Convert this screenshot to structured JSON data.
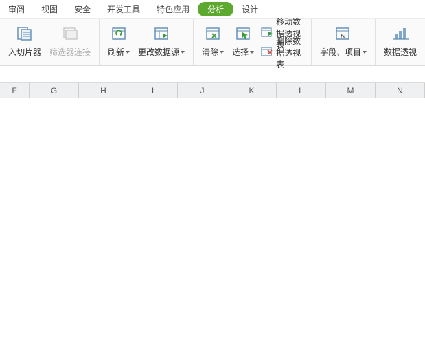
{
  "tabs": {
    "review": "审阅",
    "view": "视图",
    "security": "安全",
    "devtools": "开发工具",
    "featured": "特色应用",
    "analysis": "分析",
    "design": "设计"
  },
  "ribbon": {
    "slicer": "入切片器",
    "filter_conn": "筛选器连接",
    "refresh": "刷新",
    "change_source": "更改数据源",
    "clear": "清除",
    "select": "选择",
    "move_pivot": "移动数据透视表",
    "delete_pivot": "删除数据透视表",
    "fields_items": "字段、项目",
    "pivot_chart_partial": "数据透视"
  },
  "columns": [
    "F",
    "G",
    "H",
    "I",
    "J",
    "K",
    "L",
    "M",
    "N"
  ],
  "icons": {
    "slicer": "slicer-icon",
    "filter": "filter-icon",
    "refresh": "refresh-icon",
    "data_source": "data-source-icon",
    "clear": "clear-icon",
    "select": "select-icon",
    "move": "move-arrow-icon",
    "delete": "delete-x-icon",
    "fx": "fx-icon",
    "chart": "pivot-chart-icon"
  }
}
